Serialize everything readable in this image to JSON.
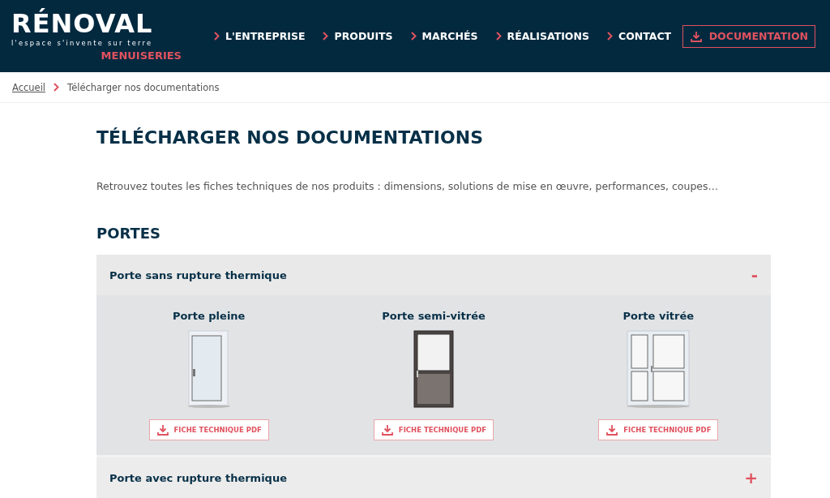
{
  "header": {
    "logo": "RÉNOVAL",
    "tagline": "l'espace s'invente sur terre",
    "sublogo": "MENUISERIES",
    "nav": [
      {
        "label": "L'ENTREPRISE"
      },
      {
        "label": "PRODUITS"
      },
      {
        "label": "MARCHÉS"
      },
      {
        "label": "RÉALISATIONS"
      },
      {
        "label": "CONTACT"
      }
    ],
    "cta": "DOCUMENTATION"
  },
  "breadcrumb": [
    {
      "label": "Accueil",
      "kind": "link"
    },
    {
      "label": "Télécharger nos documentations",
      "kind": "current"
    }
  ],
  "title": "TÉLÉCHARGER NOS DOCUMENTATIONS",
  "intro": "Retrouvez toutes les fiches techniques de nos produits : dimensions, solutions de mise en œuvre, performances, coupes…",
  "section": "PORTES",
  "accordions": [
    {
      "title": "Porte sans rupture thermique",
      "expanded": true,
      "toggle": "-",
      "products": [
        {
          "name": "Porte pleine",
          "kind": "plain",
          "button": "FICHE TECHNIQUE PDF"
        },
        {
          "name": "Porte semi-vitrée",
          "kind": "half-glazed",
          "button": "FICHE TECHNIQUE PDF"
        },
        {
          "name": "Porte vitrée",
          "kind": "glazed",
          "button": "FICHE TECHNIQUE PDF"
        }
      ]
    },
    {
      "title": "Porte avec rupture thermique",
      "expanded": false,
      "toggle": "+"
    }
  ]
}
